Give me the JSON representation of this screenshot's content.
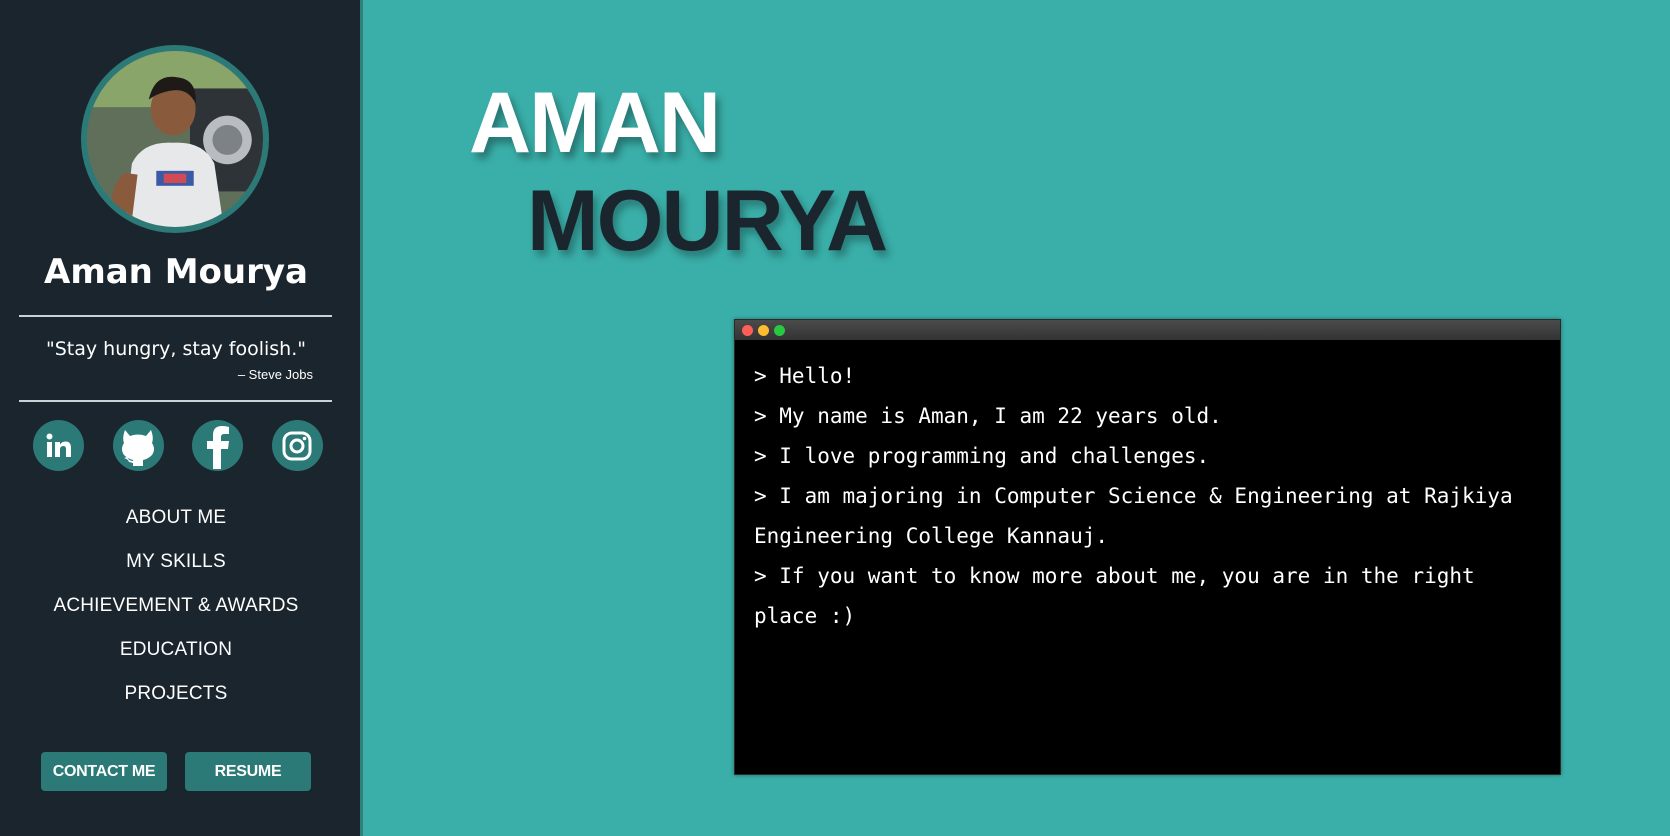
{
  "sidebar": {
    "name": "Aman Mourya",
    "quote": "\"Stay hungry, stay foolish.\"",
    "quote_author": "– Steve Jobs",
    "socials": [
      {
        "icon": "linkedin-icon"
      },
      {
        "icon": "github-icon"
      },
      {
        "icon": "facebook-icon"
      },
      {
        "icon": "instagram-icon"
      }
    ],
    "nav": [
      "ABOUT ME",
      "MY SKILLS",
      "ACHIEVEMENT & AWARDS",
      "EDUCATION",
      "PROJECTS"
    ],
    "buttons": {
      "contact": "CONTACT ME",
      "resume": "RESUME"
    }
  },
  "hero": {
    "first_name": "AMAN",
    "last_name": "MOURYA"
  },
  "terminal": {
    "lines": [
      "> Hello!",
      "> My name is Aman, I am 22 years old.",
      "> I love programming and challenges.",
      "> I am majoring in Computer Science & Engineering at Rajkiya Engineering College Kannauj.",
      "> If you want to know more about me, you are in the right place :)"
    ]
  },
  "colors": {
    "background": "#3aafa9",
    "sidebar": "#1b252d",
    "accent": "#2b7a77",
    "terminal": "#000000",
    "dot_red": "#ff5f57",
    "dot_yellow": "#febc2e",
    "dot_green": "#28c840"
  }
}
